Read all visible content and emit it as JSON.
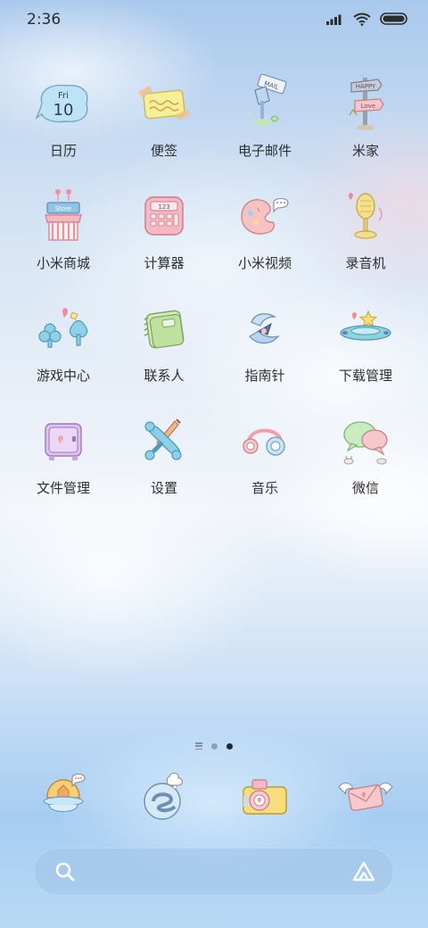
{
  "status_bar": {
    "time": "2:36",
    "icons": [
      "signal-icon",
      "wifi-icon",
      "battery-icon"
    ]
  },
  "apps": [
    {
      "label": "日历",
      "icon": "calendar-icon",
      "calendar_day": "Fri",
      "calendar_date": "10"
    },
    {
      "label": "便签",
      "icon": "notes-icon"
    },
    {
      "label": "电子邮件",
      "icon": "email-icon",
      "sign_text": "MAIL"
    },
    {
      "label": "米家",
      "icon": "mi-home-icon",
      "sign_top": "HAPPY",
      "sign_bottom": "Love"
    },
    {
      "label": "小米商城",
      "icon": "store-icon",
      "sign_text": "Store"
    },
    {
      "label": "计算器",
      "icon": "calculator-icon",
      "display_text": "123"
    },
    {
      "label": "小米视频",
      "icon": "video-icon"
    },
    {
      "label": "录音机",
      "icon": "recorder-icon"
    },
    {
      "label": "游戏中心",
      "icon": "game-center-icon"
    },
    {
      "label": "联系人",
      "icon": "contacts-icon"
    },
    {
      "label": "指南针",
      "icon": "compass-icon"
    },
    {
      "label": "下载管理",
      "icon": "downloads-icon"
    },
    {
      "label": "文件管理",
      "icon": "file-manager-icon"
    },
    {
      "label": "设置",
      "icon": "settings-icon"
    },
    {
      "label": "音乐",
      "icon": "music-icon"
    },
    {
      "label": "微信",
      "icon": "wechat-icon"
    }
  ],
  "page_indicator": {
    "pages": 2,
    "active_page": 2
  },
  "dock": [
    {
      "icon": "phone-icon"
    },
    {
      "icon": "browser-icon"
    },
    {
      "icon": "camera-icon"
    },
    {
      "icon": "messages-icon"
    }
  ],
  "search_bar": {
    "icons": [
      "search-icon",
      "assistant-icon"
    ]
  },
  "colors": {
    "sky_top": "#a9c9ec",
    "sky_mid": "#f2f5fa",
    "sky_bottom": "#a6cdf1",
    "label_text": "#2f2f2f",
    "active_dot": "#1f2733"
  }
}
